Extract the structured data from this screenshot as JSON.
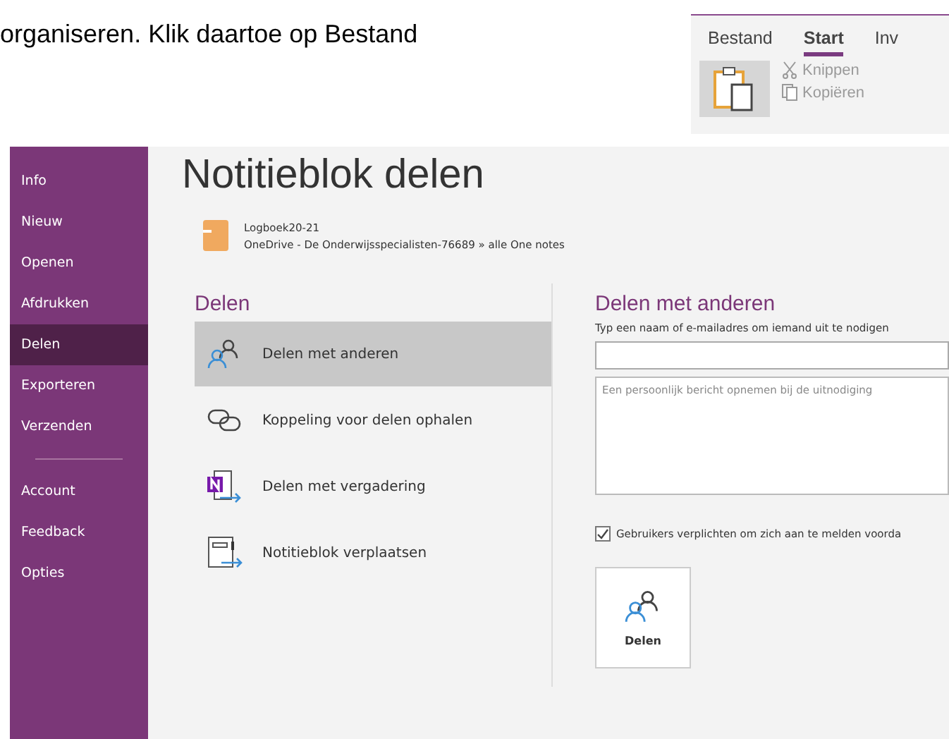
{
  "document_text": "organiseren. Klik daartoe op Bestand",
  "ribbon": {
    "tabs": [
      {
        "label": "Bestand",
        "selected": false
      },
      {
        "label": "Start",
        "selected": true
      },
      {
        "label": "Inv",
        "selected": false
      }
    ],
    "commands": [
      {
        "label": "Knippen",
        "disabled": true
      },
      {
        "label": "Kopiëren",
        "disabled": true
      }
    ]
  },
  "sidebar": {
    "items": [
      {
        "label": "Info",
        "selected": false
      },
      {
        "label": "Nieuw",
        "selected": false
      },
      {
        "label": "Openen",
        "selected": false
      },
      {
        "label": "Afdrukken",
        "selected": false
      },
      {
        "label": "Delen",
        "selected": true
      },
      {
        "label": "Exporteren",
        "selected": false
      },
      {
        "label": "Verzenden",
        "selected": false
      }
    ],
    "bottom_items": [
      {
        "label": "Account",
        "selected": false
      },
      {
        "label": "Feedback",
        "selected": false
      },
      {
        "label": "Opties",
        "selected": false
      }
    ]
  },
  "page_title": "Notitieblok delen",
  "notebook": {
    "name": "Logboek20-21",
    "location": "OneDrive - De Onderwijsspecialisten-76689 » alle One notes"
  },
  "share_section": {
    "heading": "Delen",
    "options": [
      {
        "kind": "people",
        "label": "Delen met anderen",
        "selected": true
      },
      {
        "kind": "link",
        "label": "Koppeling voor delen ophalen",
        "selected": false
      },
      {
        "kind": "meeting",
        "label": "Delen met vergadering",
        "selected": false
      },
      {
        "kind": "move",
        "label": "Notitieblok verplaatsen",
        "selected": false
      }
    ]
  },
  "share_panel": {
    "heading": "Delen met anderen",
    "invite_label": "Typ een naam of e-mailadres om iemand uit te nodigen",
    "message_placeholder": "Een persoonlijk bericht opnemen bij de uitnodiging",
    "require_signin": {
      "label": "Gebruikers verplichten om zich aan te melden voorda",
      "checked": true
    },
    "share_button": "Delen"
  }
}
